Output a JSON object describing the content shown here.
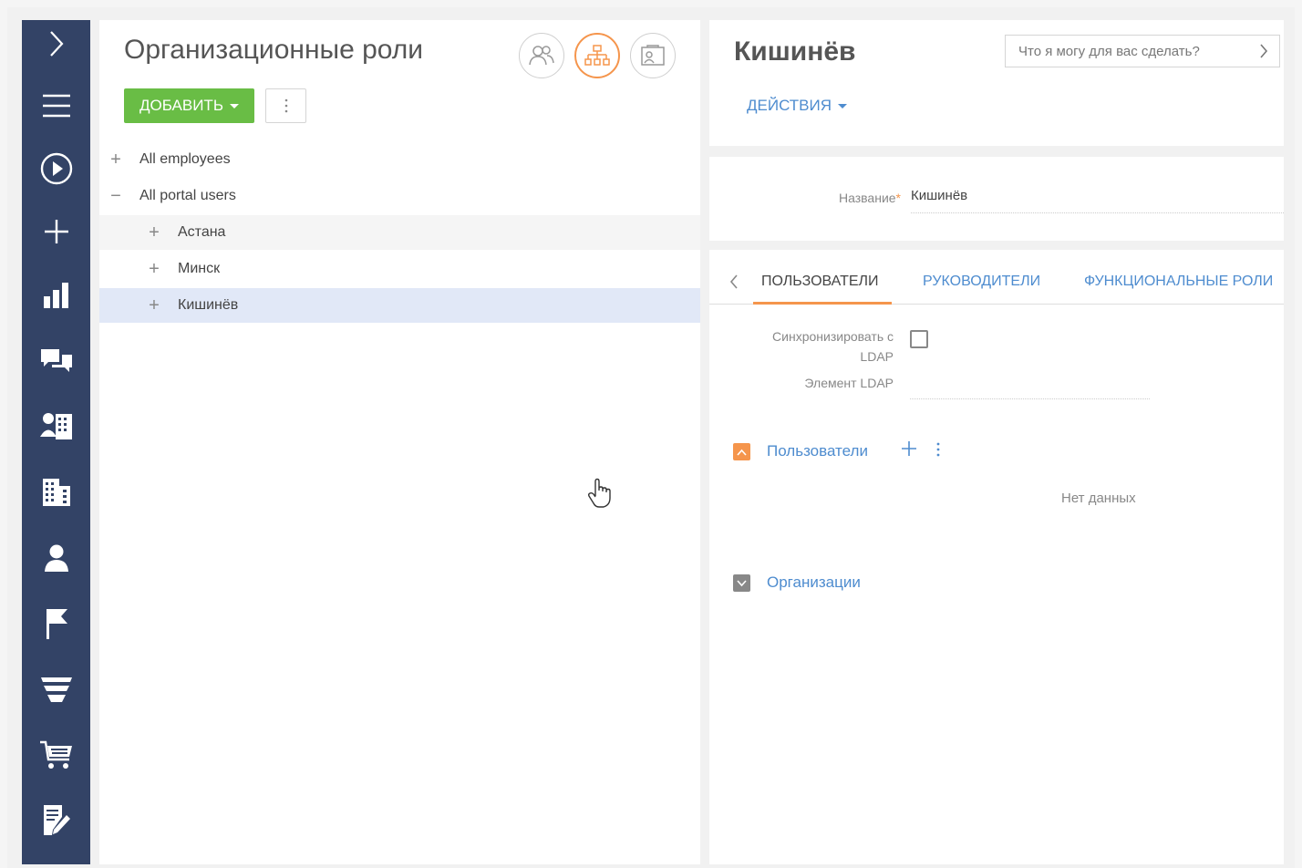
{
  "left_panel": {
    "title": "Организационные роли",
    "add_label": "ДОБАВИТЬ",
    "tree": [
      {
        "toggle": "+",
        "label": "All employees"
      },
      {
        "toggle": "−",
        "label": "All portal users"
      },
      {
        "toggle": "+",
        "label": "Астана"
      },
      {
        "toggle": "+",
        "label": "Минск"
      },
      {
        "toggle": "+",
        "label": "Кишинёв"
      }
    ]
  },
  "record": {
    "title": "Кишинёв",
    "assistant_placeholder": "Что я могу для вас сделать?",
    "actions_label": "ДЕЙСТВИЯ",
    "name_label": "Название",
    "name_value": "Кишинёв"
  },
  "tabs": [
    "ПОЛЬЗОВАТЕЛИ",
    "РУКОВОДИТЕЛИ",
    "ФУНКЦИОНАЛЬНЫЕ РОЛИ"
  ],
  "detail": {
    "sync_label_line1": "Синхронизировать с",
    "sync_label_line2": "LDAP",
    "ldap_element_label": "Элемент LDAP",
    "users_group": "Пользователи",
    "no_data": "Нет данных",
    "orgs_group": "Организации"
  },
  "colors": {
    "sidebar": "#334366",
    "accent_orange": "#f5954c",
    "add_green": "#69bd45",
    "link_blue": "#4e8ccf",
    "selected_row": "#e1e8f7"
  },
  "sidebar_icons": [
    "chevron-right-icon",
    "menu-icon",
    "play-icon",
    "plus-icon",
    "chart-icon",
    "chat-icon",
    "contacts-icon",
    "building-icon",
    "person-icon",
    "flag-icon",
    "funnel-icon",
    "cart-icon",
    "document-edit-icon"
  ]
}
